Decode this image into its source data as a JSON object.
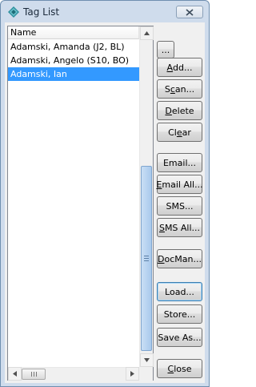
{
  "window": {
    "title": "Tag List"
  },
  "list": {
    "column_header": "Name",
    "rows": [
      "Adamski, Amanda (J2, BL)",
      "Adamski, Angelo (S10, BO)",
      "Adamski, Ian"
    ],
    "selected_index": 2
  },
  "buttons": {
    "more": "...",
    "add": {
      "mnemonic": "A",
      "rest": "dd..."
    },
    "scan": {
      "pre": "S",
      "mnemonic": "c",
      "rest": "an..."
    },
    "delete": {
      "mnemonic": "D",
      "rest": "elete"
    },
    "clear": {
      "pre": "Cl",
      "mnemonic": "e",
      "rest": "ar"
    },
    "email": {
      "pre": "Email",
      "mnemonic": "",
      "rest": "..."
    },
    "email_all": {
      "mnemonic": "E",
      "rest": "mail All..."
    },
    "sms": {
      "pre": "SMS...",
      "mnemonic": "",
      "rest": ""
    },
    "sms_all": {
      "mnemonic": "S",
      "rest": "MS All..."
    },
    "docman": {
      "mnemonic": "D",
      "rest": "ocMan..."
    },
    "load": "Load...",
    "store": "Store...",
    "save_as": "Save As...",
    "close": {
      "mnemonic": "C",
      "rest": "lose"
    }
  },
  "colors": {
    "selection": "#3399ff",
    "title_bar": "#cfdcec"
  }
}
